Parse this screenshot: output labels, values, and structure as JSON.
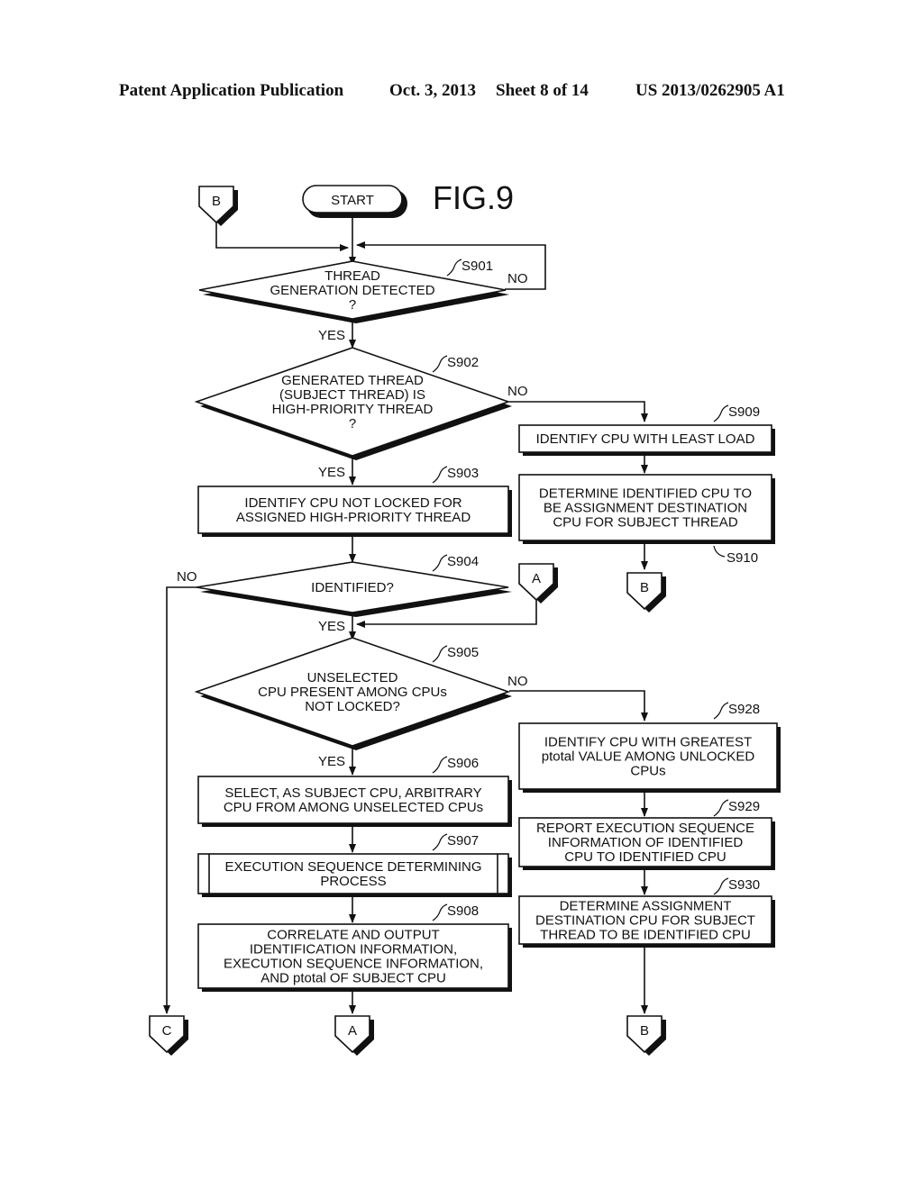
{
  "header": {
    "publication": "Patent Application Publication",
    "date": "Oct. 3, 2013",
    "sheet": "Sheet 8 of 14",
    "number": "US 2013/0262905 A1"
  },
  "figure": {
    "title": "FIG.9",
    "start": "START",
    "connectors": {
      "b_top": "B",
      "a_right": "A",
      "b_mid": "B",
      "c_bottom": "C",
      "a_bottom": "A",
      "b_bottom": "B"
    },
    "branch": {
      "yes": "YES",
      "no": "NO"
    },
    "steps": {
      "s901": {
        "id": "S901",
        "lines": [
          "THREAD",
          "GENERATION DETECTED",
          "?"
        ]
      },
      "s902": {
        "id": "S902",
        "lines": [
          "GENERATED THREAD",
          "(SUBJECT THREAD) IS",
          "HIGH-PRIORITY THREAD",
          "?"
        ]
      },
      "s903": {
        "id": "S903",
        "lines": [
          "IDENTIFY CPU NOT LOCKED FOR",
          "ASSIGNED HIGH-PRIORITY THREAD"
        ]
      },
      "s904": {
        "id": "S904",
        "lines": [
          "IDENTIFIED?"
        ]
      },
      "s905": {
        "id": "S905",
        "lines": [
          "UNSELECTED",
          "CPU PRESENT AMONG CPUs",
          "NOT LOCKED?"
        ]
      },
      "s906": {
        "id": "S906",
        "lines": [
          "SELECT, AS SUBJECT CPU, ARBITRARY",
          "CPU FROM AMONG UNSELECTED CPUs"
        ]
      },
      "s907": {
        "id": "S907",
        "lines": [
          "EXECUTION SEQUENCE DETERMINING",
          "PROCESS"
        ]
      },
      "s908": {
        "id": "S908",
        "lines": [
          "CORRELATE AND OUTPUT",
          "IDENTIFICATION INFORMATION,",
          "EXECUTION SEQUENCE INFORMATION,",
          "AND ptotal OF SUBJECT CPU"
        ]
      },
      "s909": {
        "id": "S909",
        "lines": [
          "IDENTIFY CPU WITH LEAST LOAD"
        ]
      },
      "s910": {
        "id": "S910",
        "lines": [
          "DETERMINE IDENTIFIED CPU TO",
          "BE ASSIGNMENT DESTINATION",
          "CPU FOR SUBJECT THREAD"
        ]
      },
      "s928": {
        "id": "S928",
        "lines": [
          "IDENTIFY CPU WITH GREATEST",
          "ptotal VALUE AMONG UNLOCKED",
          "CPUs"
        ]
      },
      "s929": {
        "id": "S929",
        "lines": [
          "REPORT EXECUTION SEQUENCE",
          "INFORMATION OF IDENTIFIED",
          "CPU TO IDENTIFIED CPU"
        ]
      },
      "s930": {
        "id": "S930",
        "lines": [
          "DETERMINE ASSIGNMENT",
          "DESTINATION CPU FOR SUBJECT",
          "THREAD TO BE IDENTIFIED CPU"
        ]
      }
    }
  }
}
